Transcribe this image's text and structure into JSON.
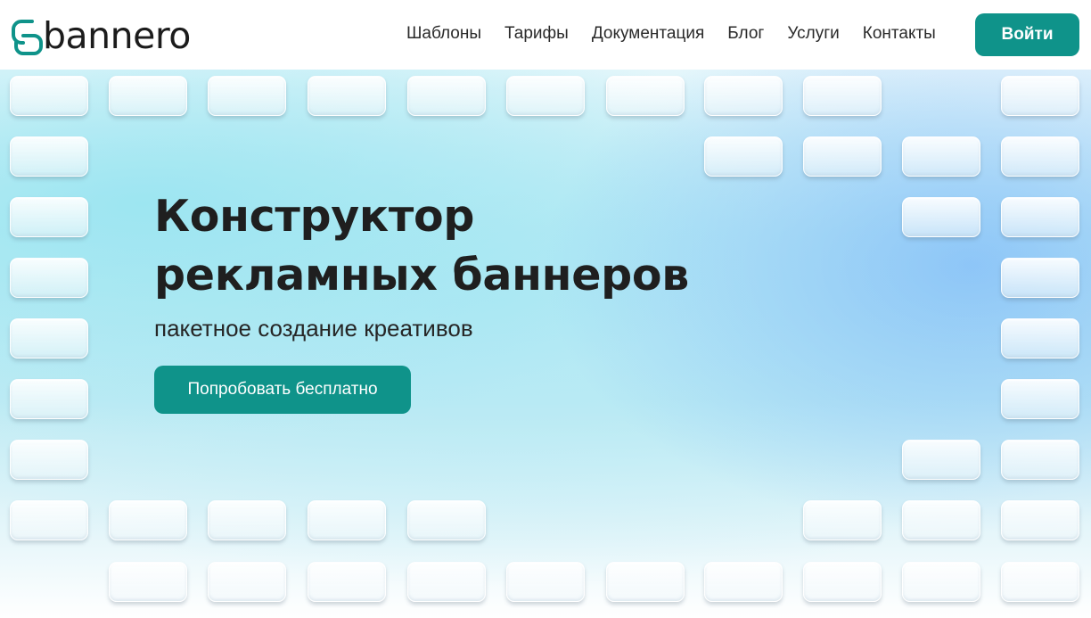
{
  "header": {
    "logo_text": "bannero",
    "nav": [
      "Шаблоны",
      "Тарифы",
      "Документация",
      "Блог",
      "Услуги",
      "Контакты"
    ],
    "login_label": "Войти"
  },
  "hero": {
    "title_line1": "Конструктор",
    "title_line2": "рекламных баннеров",
    "subtitle": "пакетное создание креативов",
    "cta_label": "Попробовать бесплатно"
  },
  "colors": {
    "accent": "#0f938a",
    "text": "#1f1f1f",
    "background_tint": "#c4ecf4"
  },
  "icons": {
    "logo_mark": "rounded-link-logo-icon"
  }
}
